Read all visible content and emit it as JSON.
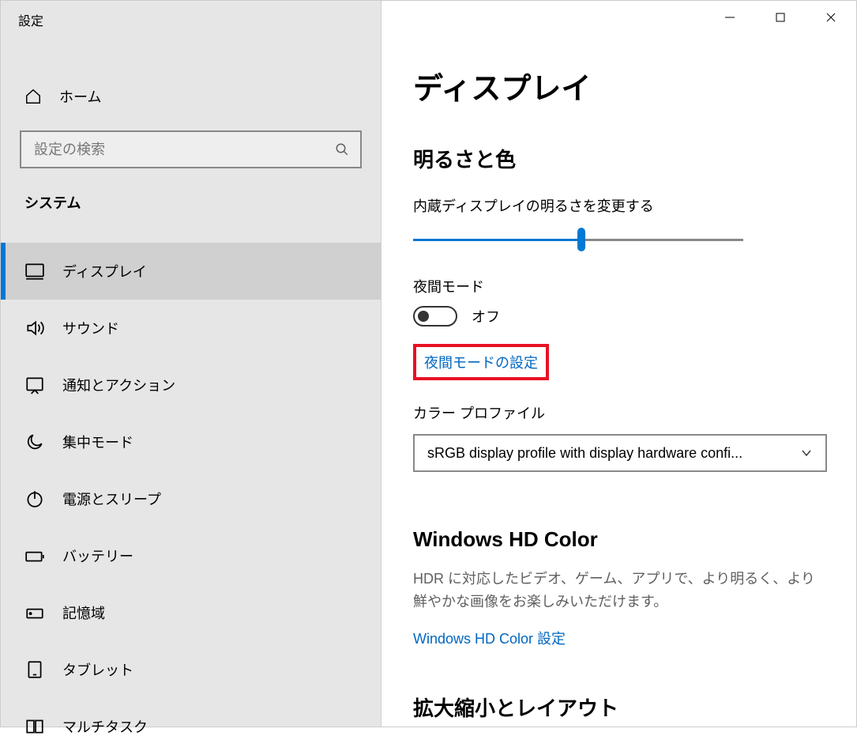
{
  "app_title": "設定",
  "home_label": "ホーム",
  "search_placeholder": "設定の検索",
  "category_label": "システム",
  "nav": [
    {
      "label": "ディスプレイ",
      "icon": "monitor",
      "active": true
    },
    {
      "label": "サウンド",
      "icon": "sound",
      "active": false
    },
    {
      "label": "通知とアクション",
      "icon": "notification",
      "active": false
    },
    {
      "label": "集中モード",
      "icon": "moon",
      "active": false
    },
    {
      "label": "電源とスリープ",
      "icon": "power",
      "active": false
    },
    {
      "label": "バッテリー",
      "icon": "battery",
      "active": false
    },
    {
      "label": "記憶域",
      "icon": "storage",
      "active": false
    },
    {
      "label": "タブレット",
      "icon": "tablet",
      "active": false
    },
    {
      "label": "マルチタスク",
      "icon": "multitask",
      "active": false
    }
  ],
  "page_title": "ディスプレイ",
  "brightness_section": "明るさと色",
  "brightness_label": "内蔵ディスプレイの明るさを変更する",
  "brightness_value_percent": 51,
  "night_mode_label": "夜間モード",
  "night_mode_state": "オフ",
  "night_mode_settings_link": "夜間モードの設定",
  "color_profile_label": "カラー プロファイル",
  "color_profile_value": "sRGB display profile with display hardware confi...",
  "hd_color_title": "Windows HD Color",
  "hd_color_body": "HDR に対応したビデオ、ゲーム、アプリで、より明るく、より鮮やかな画像をお楽しみいただけます。",
  "hd_color_link": "Windows HD Color 設定",
  "scaling_title": "拡大縮小とレイアウト"
}
